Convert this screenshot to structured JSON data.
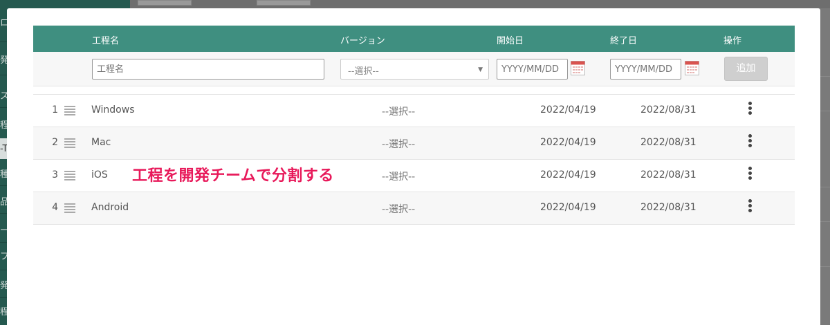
{
  "table": {
    "headers": {
      "name": "工程名",
      "version": "バージョン",
      "start": "開始日",
      "end": "終了日",
      "action": "操作"
    },
    "form": {
      "name_placeholder": "工程名",
      "version_selected": "--選択--",
      "start_placeholder": "YYYY/MM/DD",
      "end_placeholder": "YYYY/MM/DD",
      "add_label": "追加"
    },
    "rows": [
      {
        "num": "1",
        "name": "Windows",
        "version": "--選択--",
        "start": "2022/04/19",
        "end": "2022/08/31"
      },
      {
        "num": "2",
        "name": "Mac",
        "version": "--選択--",
        "start": "2022/04/19",
        "end": "2022/08/31"
      },
      {
        "num": "3",
        "name": "iOS",
        "version": "--選択--",
        "start": "2022/04/19",
        "end": "2022/08/31"
      },
      {
        "num": "4",
        "name": "Android",
        "version": "--選択--",
        "start": "2022/04/19",
        "end": "2022/08/31"
      }
    ]
  },
  "annotation": "工程を開発チームで分割する",
  "colors": {
    "header_bg": "#3f8f80",
    "annotation": "#e8195a",
    "sidebar_bg": "#25594f"
  },
  "icons": {
    "calendar": "calendar-icon",
    "drag": "drag-handle-icon",
    "menu": "kebab-menu-icon",
    "dropdown": "chevron-down-icon"
  },
  "background": {
    "sidebar_fragments": [
      "ロー",
      "発",
      "ス",
      "程",
      "-T",
      "種",
      "品",
      "ー",
      "フ",
      "発",
      "程"
    ]
  }
}
